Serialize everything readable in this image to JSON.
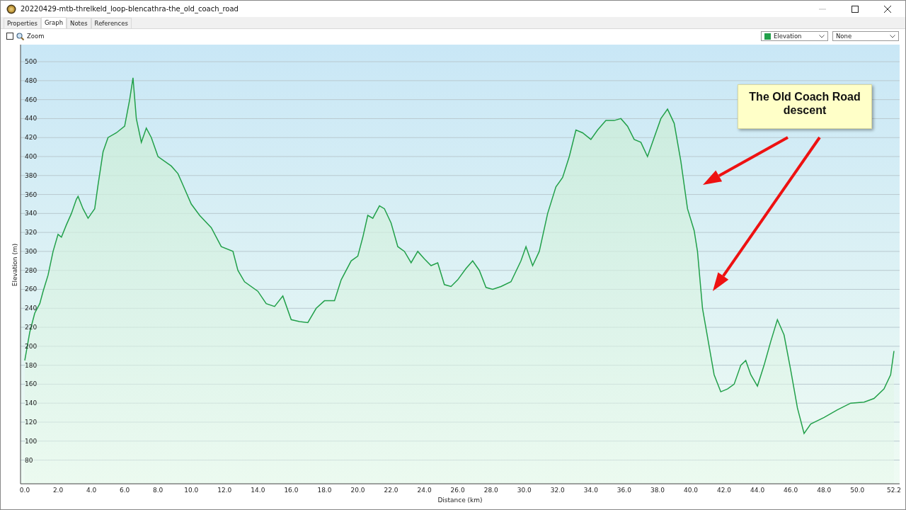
{
  "window": {
    "title": "20220429-mtb-threlkeld_loop-blencathra-the_old_coach_road"
  },
  "tabs": [
    {
      "label": "Properties",
      "selected": false
    },
    {
      "label": "Graph",
      "selected": true
    },
    {
      "label": "Notes",
      "selected": false
    },
    {
      "label": "References",
      "selected": false
    }
  ],
  "toolbar": {
    "zoom": {
      "label": "Zoom",
      "checked": false
    },
    "second_select": {
      "value": "None"
    }
  },
  "graph": {
    "chart_data": {
      "type": "area",
      "grid": true,
      "xlabel": "Distance  (km)",
      "ylabel": "Elevation (m)",
      "xlim": [
        0,
        52.2
      ],
      "ylim": [
        55,
        518
      ],
      "xticks": [
        {
          "value": 0,
          "label": "0.0"
        },
        {
          "value": 2,
          "label": "2.0"
        },
        {
          "value": 4,
          "label": "4.0"
        },
        {
          "value": 6,
          "label": "6.0"
        },
        {
          "value": 8,
          "label": "8.0"
        },
        {
          "value": 10,
          "label": "10.0"
        },
        {
          "value": 12,
          "label": "12.0"
        },
        {
          "value": 14,
          "label": "14.0"
        },
        {
          "value": 16,
          "label": "16.0"
        },
        {
          "value": 18,
          "label": "18.0"
        },
        {
          "value": 20,
          "label": "20.0"
        },
        {
          "value": 22,
          "label": "22.0"
        },
        {
          "value": 24,
          "label": "24.0"
        },
        {
          "value": 26,
          "label": "26.0"
        },
        {
          "value": 28,
          "label": "28.0"
        },
        {
          "value": 30,
          "label": "30.0"
        },
        {
          "value": 32,
          "label": "32.0"
        },
        {
          "value": 34,
          "label": "34.0"
        },
        {
          "value": 36,
          "label": "36.0"
        },
        {
          "value": 38,
          "label": "38.0"
        },
        {
          "value": 40,
          "label": "40.0"
        },
        {
          "value": 42,
          "label": "42.0"
        },
        {
          "value": 44,
          "label": "44.0"
        },
        {
          "value": 46,
          "label": "46.0"
        },
        {
          "value": 48,
          "label": "48.0"
        },
        {
          "value": 50,
          "label": "50.0"
        },
        {
          "value": 52.2,
          "label": "52.2"
        }
      ],
      "yticks": [
        80,
        100,
        120,
        140,
        160,
        180,
        200,
        220,
        240,
        260,
        280,
        300,
        320,
        340,
        360,
        380,
        400,
        420,
        440,
        460,
        480,
        500
      ],
      "x": [
        0,
        0.3,
        0.6,
        0.9,
        1.1,
        1.4,
        1.7,
        2.0,
        2.2,
        2.5,
        2.8,
        3.1,
        3.2,
        3.5,
        3.8,
        4.0,
        4.2,
        4.4,
        4.7,
        5.0,
        5.5,
        6.0,
        6.3,
        6.5,
        6.7,
        7.0,
        7.3,
        7.6,
        8.0,
        8.8,
        9.2,
        9.5,
        10.0,
        10.5,
        11.2,
        11.8,
        12.5,
        12.8,
        13.2,
        14.0,
        14.5,
        15.0,
        15.5,
        16.0,
        16.5,
        17.0,
        17.5,
        18.0,
        18.6,
        19.0,
        19.6,
        20.0,
        20.3,
        20.6,
        20.9,
        21.3,
        21.6,
        22.0,
        22.4,
        22.8,
        23.2,
        23.6,
        24.0,
        24.4,
        24.8,
        25.2,
        25.6,
        26.0,
        26.5,
        26.9,
        27.3,
        27.7,
        28.1,
        28.6,
        29.2,
        29.8,
        30.1,
        30.5,
        30.9,
        31.4,
        31.9,
        32.3,
        32.7,
        33.1,
        33.5,
        34.0,
        34.4,
        34.9,
        35.4,
        35.8,
        36.2,
        36.6,
        37.0,
        37.4,
        37.8,
        38.2,
        38.6,
        39.0,
        39.4,
        39.8,
        40.2,
        40.4,
        40.7,
        41.0,
        41.4,
        41.8,
        42.2,
        42.6,
        43.0,
        43.3,
        43.6,
        44.0,
        44.4,
        44.8,
        45.2,
        45.6,
        46.0,
        46.4,
        46.8,
        47.2,
        48.0,
        48.8,
        49.6,
        50.4,
        51.0,
        51.6,
        52.0,
        52.2
      ],
      "series": [
        {
          "name": "Elevation",
          "color": "#22a04a",
          "values": [
            185,
            215,
            235,
            245,
            258,
            275,
            300,
            318,
            315,
            328,
            340,
            355,
            358,
            345,
            335,
            340,
            345,
            370,
            405,
            420,
            425,
            432,
            460,
            483,
            440,
            415,
            430,
            420,
            400,
            390,
            382,
            370,
            350,
            338,
            325,
            305,
            300,
            280,
            268,
            258,
            245,
            242,
            253,
            228,
            226,
            225,
            240,
            248,
            248,
            270,
            290,
            295,
            315,
            338,
            335,
            348,
            345,
            330,
            305,
            300,
            288,
            300,
            292,
            285,
            288,
            265,
            263,
            270,
            282,
            290,
            280,
            262,
            260,
            263,
            268,
            290,
            305,
            285,
            300,
            340,
            368,
            378,
            400,
            428,
            425,
            418,
            428,
            438,
            438,
            440,
            432,
            418,
            415,
            400,
            420,
            440,
            450,
            435,
            395,
            345,
            322,
            300,
            240,
            210,
            170,
            152,
            155,
            160,
            180,
            185,
            170,
            158,
            180,
            205,
            228,
            212,
            175,
            135,
            108,
            118,
            125,
            133,
            140,
            141,
            145,
            155,
            170,
            195
          ]
        }
      ],
      "annotations": [
        {
          "text": "The Old Coach Road descent"
        }
      ]
    }
  }
}
